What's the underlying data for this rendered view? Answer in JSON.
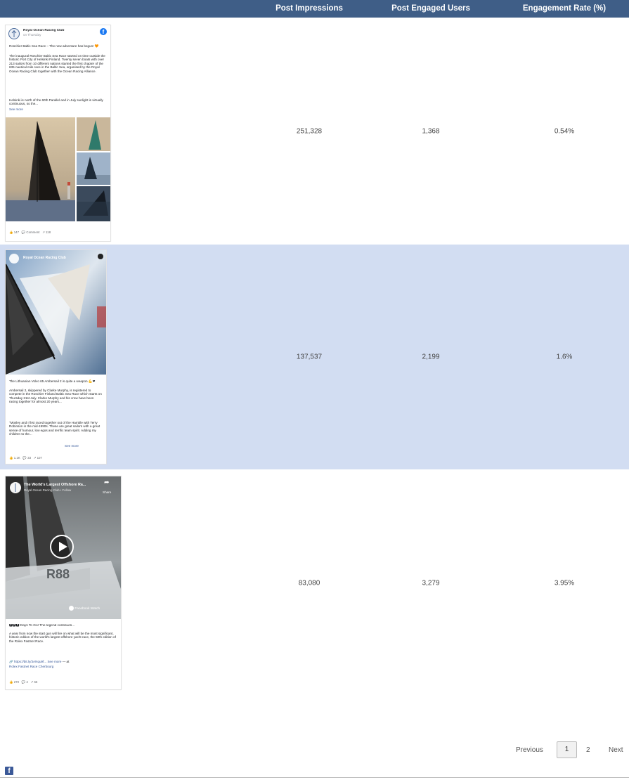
{
  "header": {
    "col_impressions": "Post Impressions",
    "col_engaged": "Post Engaged Users",
    "col_rate": "Engagement Rate (%)"
  },
  "rows": [
    {
      "impressions": "251,328",
      "engaged": "1,368",
      "rate": "0.54%",
      "post": {
        "page_name": "Royal Ocean Racing Club",
        "time": "on Thursday",
        "headline": "Roschier Baltic Sea Race – The new adventure has begun! 🧡",
        "body": "The inaugural Roschier Baltic Sea Race started on time outside the historic Port City of Helsinki Finland. Twenty seven boats with over 213 sailors from 10 different nations started the first chapter of the 635 nautical mile race in the Baltic Sea, organised by the Royal Ocean Racing Club together with the Ocean Racing Alliance.",
        "body2": "Helsinki is north of the 60th Parallel and in July sunlight is virtually continuous, so the...",
        "see_more": "See more",
        "reactions": "147",
        "comment": "Comment",
        "shares": "118"
      }
    },
    {
      "impressions": "137,537",
      "engaged": "2,199",
      "rate": "1.6%",
      "post": {
        "page_name": "Royal Ocean Racing Club",
        "headline": "The Lithuanian Volvo 65 Ambersail 2 is quite a weapon 💪❤",
        "body": "Ambersail 2, skippered by Clarke Murphy, is registered to compete in the Roschier Finland Baltic Sea Race which starts on Thursday 21st July. Clarke Murphy and his crew have been racing together for almost 20 years...",
        "body2": "\"Mosley and I first raced together out of the Hamble with Terry Robinson in the mid-1990s. These are great sailors with a great sense of humour, low egos and terrific team spirit. Adding my children to the...",
        "see_more": "See more",
        "reactions": "1.1K",
        "comments": "33",
        "shares": "107"
      }
    },
    {
      "impressions": "83,080",
      "engaged": "3,279",
      "rate": "3.95%",
      "post": {
        "video_title": "The World's Largest Offshore Ra...",
        "video_sub": "Royal Ocean Racing Club • Follow",
        "share": "Share",
        "watch": "Facebook Watch",
        "hull_text": "R88",
        "headline": "🅿🅿🅿 Days To Go! The legend continues...",
        "body": "A year from now the start gun will fire on what will be the most significant, historic edition of the world's largest offshore yacht race, the 50th edition of the Rolex Fastnet Race.",
        "link": "🔗 https://bit.ly/3ANqu9f... See more",
        "location_prefix": "— at",
        "location": "Rolex Fastnet Race Cherbourg",
        "reactions": "270",
        "comments": "4",
        "shares": "66"
      }
    }
  ],
  "pagination": {
    "previous": "Previous",
    "page1": "1",
    "page2": "2",
    "next": "Next"
  },
  "footer": {
    "fb_glyph": "f"
  },
  "colors": {
    "header_bg": "#3f5e87",
    "highlight_row": "#d2ddf2",
    "facebook_blue": "#1877f2"
  }
}
